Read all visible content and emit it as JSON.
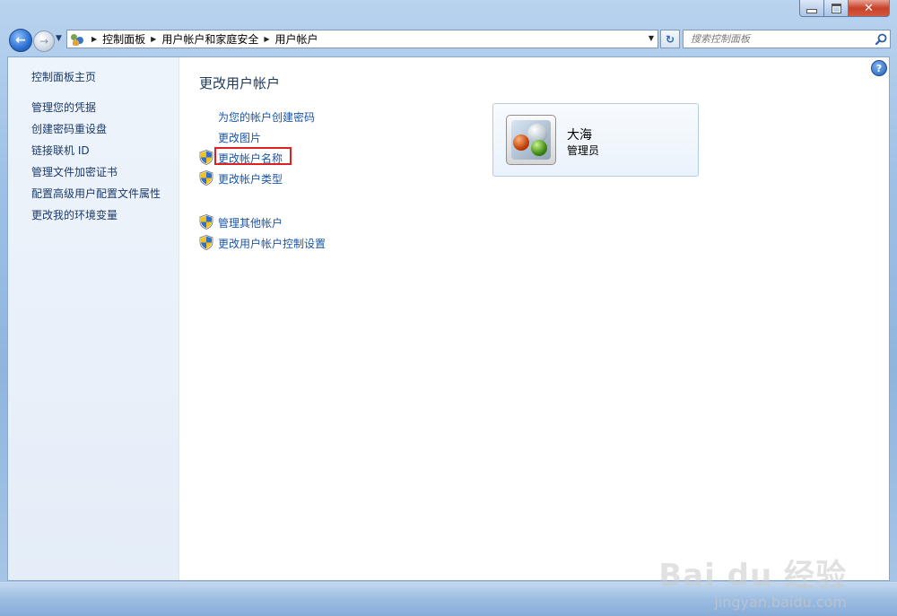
{
  "window": {
    "minimize_label": "minimize",
    "maximize_label": "maximize",
    "close_label": "close"
  },
  "nav": {
    "breadcrumb": [
      "控制面板",
      "用户帐户和家庭安全",
      "用户帐户"
    ]
  },
  "search": {
    "placeholder": "搜索控制面板"
  },
  "sidebar": {
    "home": "控制面板主页",
    "items": [
      "管理您的凭据",
      "创建密码重设盘",
      "链接联机 ID",
      "管理文件加密证书",
      "配置高级用户配置文件属性",
      "更改我的环境变量"
    ]
  },
  "main": {
    "title": "更改用户帐户",
    "tasks": [
      {
        "label": "为您的帐户创建密码",
        "shield": false
      },
      {
        "label": "更改图片",
        "shield": false
      },
      {
        "label": "更改帐户名称",
        "shield": true,
        "highlighted": true
      },
      {
        "label": "更改帐户类型",
        "shield": true
      }
    ],
    "other_tasks": [
      {
        "label": "管理其他帐户",
        "shield": true
      },
      {
        "label": "更改用户帐户控制设置",
        "shield": true
      }
    ]
  },
  "user": {
    "name": "大海",
    "role": "管理员"
  },
  "watermark": {
    "text": "Bai du 经验",
    "sub": "jingyan.baidu.com"
  },
  "colors": {
    "link": "#1a55a8",
    "title": "#1e395b",
    "highlight": "#e02020"
  }
}
